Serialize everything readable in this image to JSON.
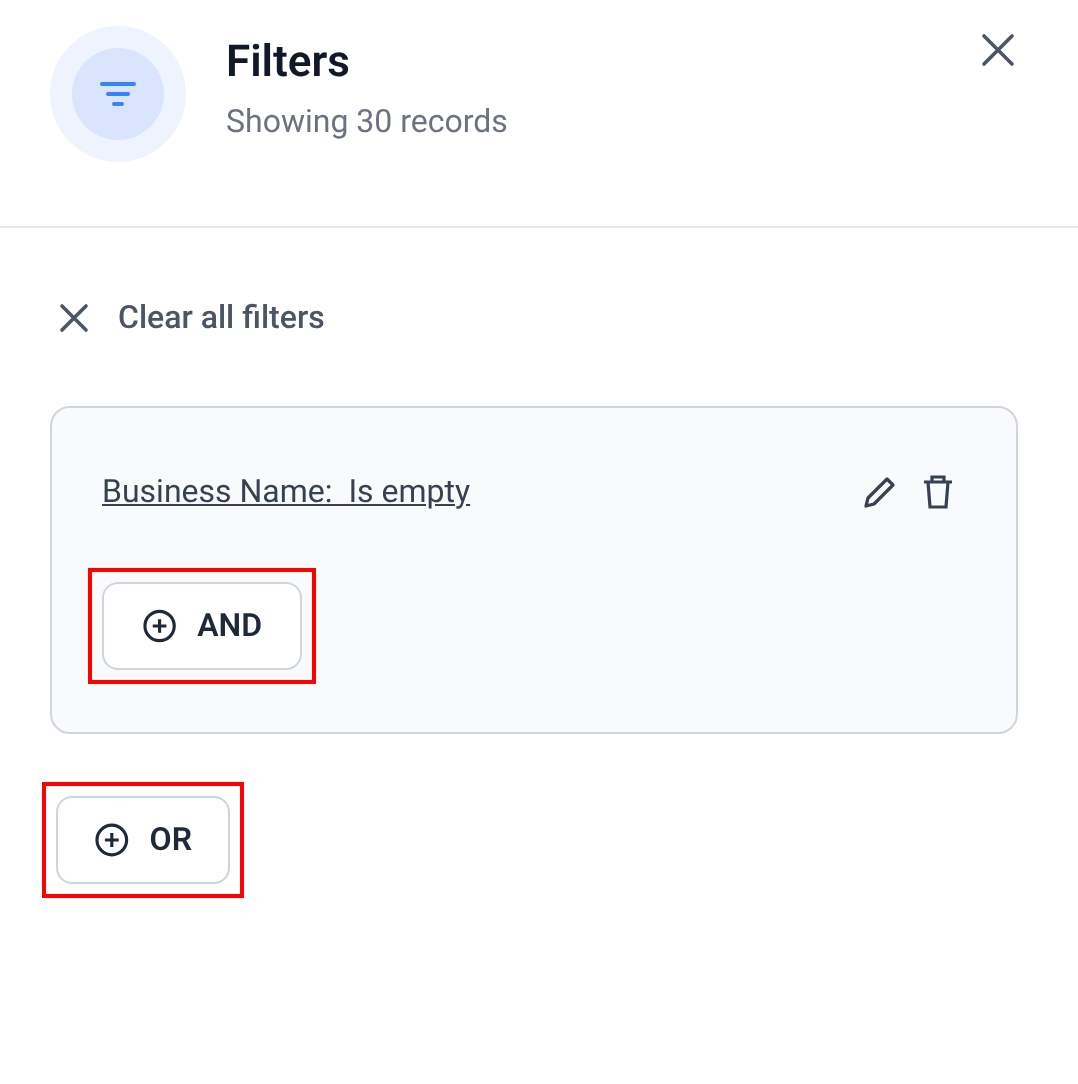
{
  "header": {
    "title": "Filters",
    "subtitle": "Showing 30 records"
  },
  "clear_all": {
    "label": "Clear all filters"
  },
  "filter_groups": [
    {
      "condition": "Business Name:  Is empty",
      "and_button": {
        "label": "AND",
        "highlighted": true
      }
    }
  ],
  "or_button": {
    "label": "OR",
    "highlighted": true
  }
}
